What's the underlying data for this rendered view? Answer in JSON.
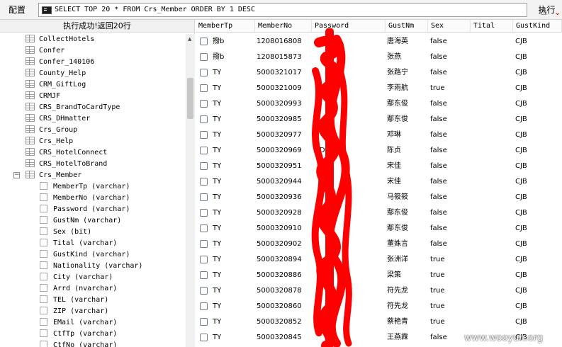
{
  "toolbar": {
    "config_label": "配置",
    "sql_query": "SELECT TOP 20 * FROM Crs_Member ORDER BY 1 DESC",
    "clear_glyph": "±",
    "dropdown_glyph": "⌄",
    "execute_label": "执行"
  },
  "left_panel": {
    "status": "执行成功!返回20行",
    "tables": [
      "CollectHotels",
      "Confer",
      "Confer_140106",
      "County_Help",
      "CRM_GiftLog",
      "CRMJF",
      "CRS_BrandToCardType",
      "CRS_DHmatter",
      "Crs_Group",
      "Crs_Help",
      "CRS_HotelConnect",
      "CRS_HotelToBrand"
    ],
    "expanded_table": "Crs_Member",
    "expander_glyph": "−",
    "columns": [
      "MemberTp (varchar)",
      "MemberNo (varchar)",
      "Password (varchar)",
      "GustNm (varchar)",
      "Sex (bit)",
      "Tital (varchar)",
      "GustKind (varchar)",
      "Nationality (varchar)",
      "City (varchar)",
      "Arrd (nvarchar)",
      "TEL (varchar)",
      "ZIP (varchar)",
      "EMail (varchar)",
      "CtfTp (varchar)",
      "CtfNo (varchar)"
    ]
  },
  "grid": {
    "headers": [
      "MemberTp",
      "MemberNo",
      "Password",
      "GustNm",
      "Sex",
      "Tital",
      "GustKind"
    ],
    "rows": [
      [
        "撥b",
        "1208016808",
        "",
        "唐海英",
        "false",
        "",
        "CJB"
      ],
      [
        "撥b",
        "1208015873",
        "",
        "张燕",
        "false",
        "",
        "CJB"
      ],
      [
        "TY",
        "5000321017",
        "",
        "张路宁",
        "false",
        "",
        "CJB"
      ],
      [
        "TY",
        "5000321009",
        "",
        "李雨航",
        "true",
        "",
        "CJB"
      ],
      [
        "TY",
        "5000320993",
        "",
        "鄢东俊",
        "false",
        "",
        "CJB"
      ],
      [
        "TY",
        "5000320985",
        "",
        "鄢东俊",
        "false",
        "",
        "CJB"
      ],
      [
        "TY",
        "5000320977",
        "",
        "邓琳",
        "false",
        "",
        "CJB"
      ],
      [
        "TY",
        "5000320969",
        "XD",
        "陈贞",
        "false",
        "",
        "CJB"
      ],
      [
        "TY",
        "5000320951",
        "",
        "宋佳",
        "false",
        "",
        "CJB"
      ],
      [
        "TY",
        "5000320944",
        "",
        "宋佳",
        "false",
        "",
        "CJB"
      ],
      [
        "TY",
        "5000320936",
        "",
        "马筱筱",
        "false",
        "",
        "CJB"
      ],
      [
        "TY",
        "5000320928",
        "",
        "鄢东俊",
        "false",
        "",
        "CJB"
      ],
      [
        "TY",
        "5000320910",
        "",
        "鄢东俊",
        "false",
        "",
        "CJB"
      ],
      [
        "TY",
        "5000320902",
        "",
        "董姝言",
        "false",
        "",
        "CJB"
      ],
      [
        "TY",
        "5000320894",
        "",
        "张洲洋",
        "true",
        "",
        "CJB"
      ],
      [
        "TY",
        "5000320886",
        "",
        "梁策",
        "true",
        "",
        "CJB"
      ],
      [
        "TY",
        "5000320878",
        "",
        "符先龙",
        "true",
        "",
        "CJB"
      ],
      [
        "TY",
        "5000320860",
        "",
        "符先龙",
        "true",
        "",
        "CJB"
      ],
      [
        "TY",
        "5000320852",
        "",
        "蔡艳青",
        "true",
        "",
        "CJB"
      ],
      [
        "TY",
        "5000320845",
        "",
        "王燕霖",
        "false",
        "",
        "CJB"
      ]
    ]
  },
  "watermark": "www.wooyun.org",
  "colors": {
    "redaction": "#ff0000",
    "checkbox_border": "#6e7c91"
  }
}
